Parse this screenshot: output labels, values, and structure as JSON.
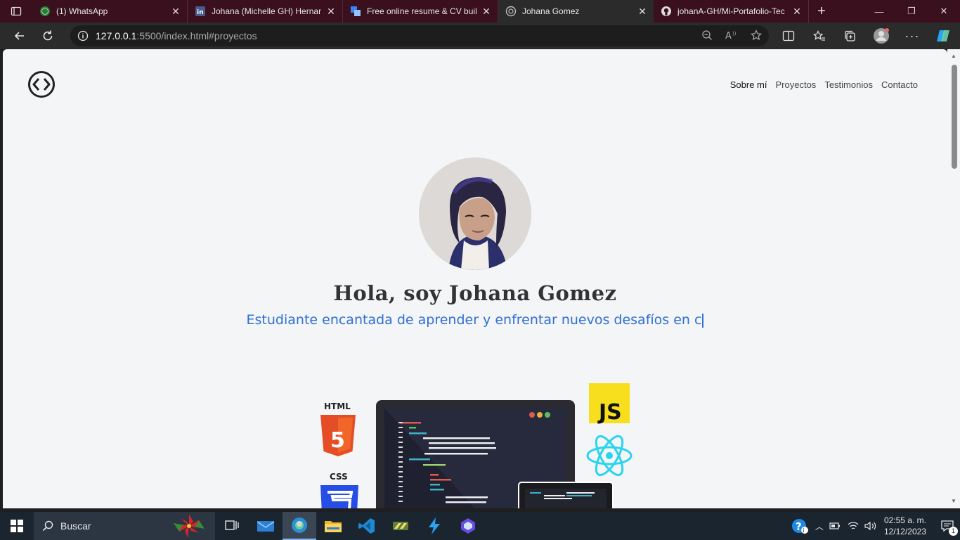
{
  "tabs": [
    {
      "title": "(1) WhatsApp",
      "icon": "whatsapp-icon",
      "active": false
    },
    {
      "title": "Johana (Michelle GH) Hernandez",
      "icon": "linkedin-icon",
      "active": false
    },
    {
      "title": "Free online resume & CV builder",
      "icon": "resume-builder-icon",
      "active": false
    },
    {
      "title": "Johana Gomez",
      "icon": "page-icon",
      "active": true
    },
    {
      "title": "johanA-GH/Mi-Portafolio-Tec",
      "icon": "github-icon",
      "active": false
    }
  ],
  "address": {
    "host": "127.0.0.1",
    "rest": ":5500/index.html#proyectos"
  },
  "nav": {
    "about": "Sobre mí",
    "projects": "Proyectos",
    "testimonials": "Testimonios",
    "contact": "Contacto"
  },
  "hero": {
    "title": "Hola, soy Johana Gomez",
    "subtitle": "Estudiante encantada de aprender y enfrentar nuevos desafíos en c"
  },
  "illustration": {
    "html_label": "HTML",
    "css_label": "CSS",
    "js_label": "JS"
  },
  "taskbar": {
    "search_placeholder": "Buscar",
    "time": "02:55 a. m.",
    "date": "12/12/2023",
    "notification_count": "1"
  },
  "colors": {
    "accent": "#2f6fd8",
    "tabstrip": "#3a0f1e",
    "taskbar": "#1b2530"
  }
}
